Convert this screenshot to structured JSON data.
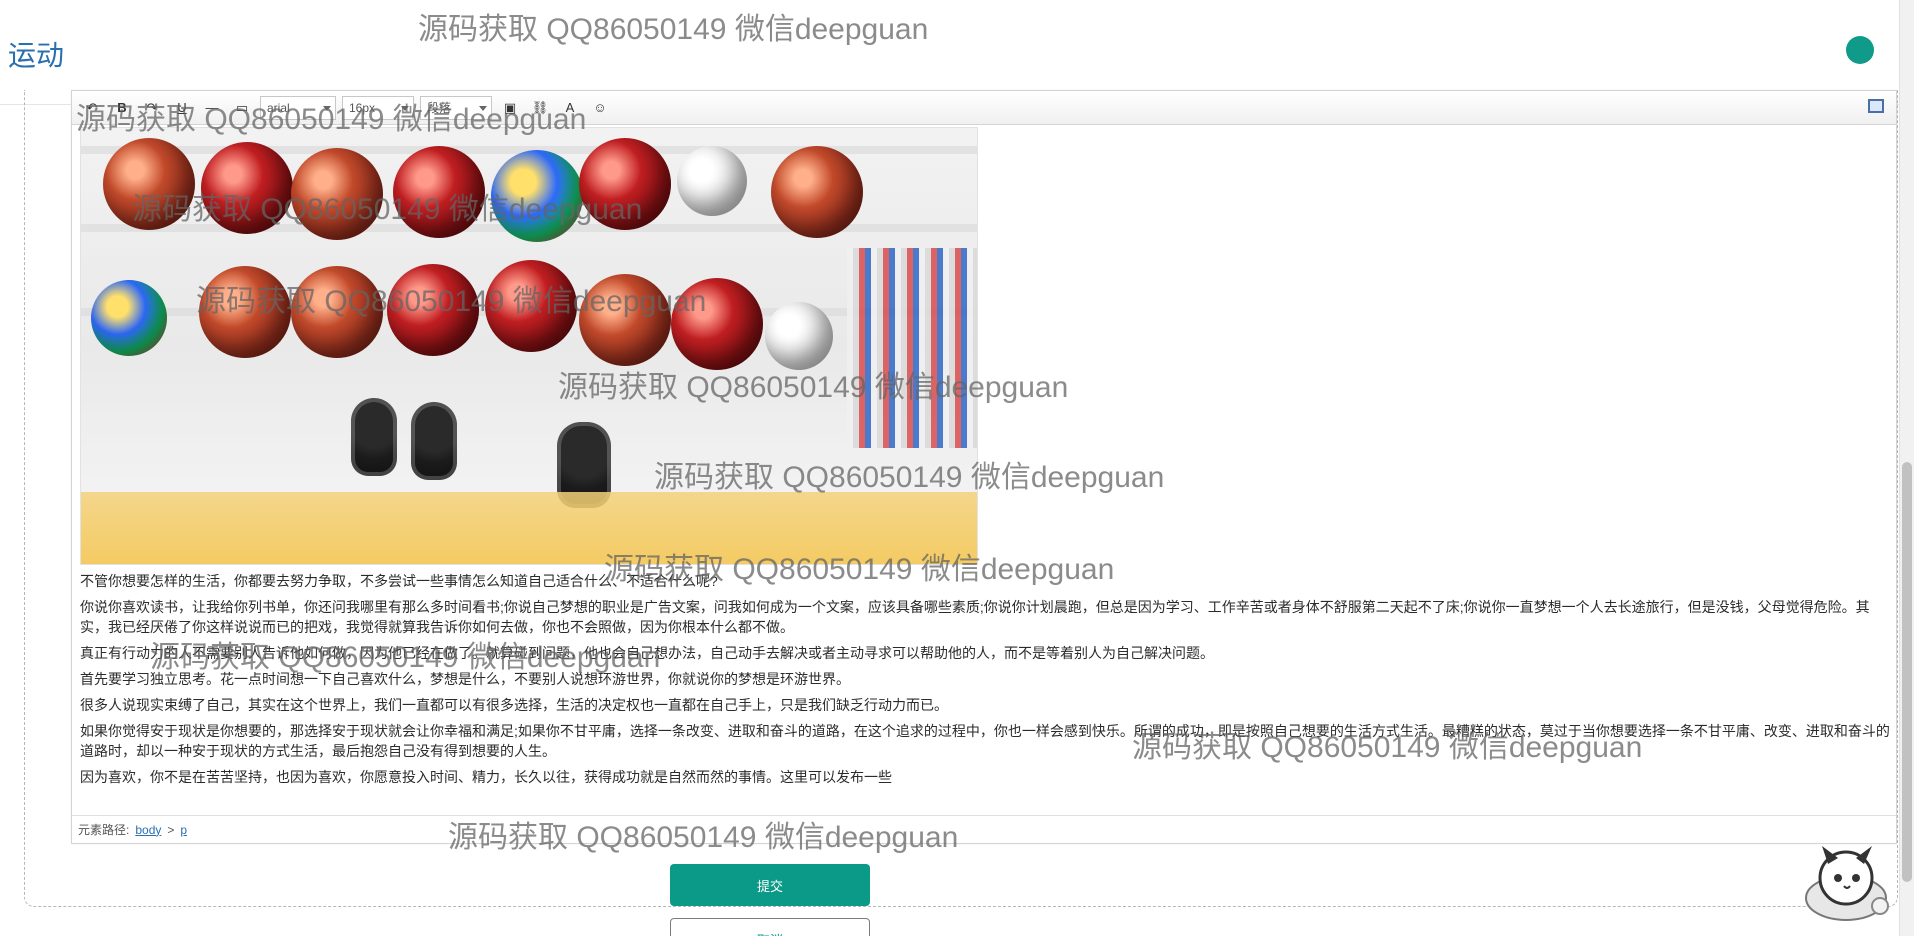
{
  "app": {
    "title": "运动"
  },
  "toolbar": {
    "font_family": "arial",
    "font_size": "16px",
    "paragraph": "段落"
  },
  "editor": {
    "image": {
      "alt_name": "sports-equipment-photo"
    },
    "paragraphs": [
      "不管你想要怎样的生活，你都要去努力争取，不多尝试一些事情怎么知道自己适合什么、不适合什么呢?",
      "你说你喜欢读书，让我给你列书单，你还问我哪里有那么多时间看书;你说自己梦想的职业是广告文案，问我如何成为一个文案，应该具备哪些素质;你说你计划晨跑，但总是因为学习、工作辛苦或者身体不舒服第二天起不了床;你说你一直梦想一个人去长途旅行，但是没钱，父母觉得危险。其实，我已经厌倦了你这样说说而已的把戏，我觉得就算我告诉你如何去做，你也不会照做，因为你根本什么都不做。",
      "真正有行动力的人不需要别人告诉他如何做，因为他已经在做了。就算碰到问题，他也会自己想办法，自己动手去解决或者主动寻求可以帮助他的人，而不是等着别人为自己解决问题。",
      "首先要学习独立思考。花一点时间想一下自己喜欢什么，梦想是什么，不要别人说想环游世界，你就说你的梦想是环游世界。",
      "很多人说现实束缚了自己，其实在这个世界上，我们一直都可以有很多选择，生活的决定权也一直都在自己手上，只是我们缺乏行动力而已。",
      "如果你觉得安于现状是你想要的，那选择安于现状就会让你幸福和满足;如果你不甘平庸，选择一条改变、进取和奋斗的道路，在这个追求的过程中，你也一样会感到快乐。所谓的成功，即是按照自己想要的生活方式生活。最糟糕的状态，莫过于当你想要选择一条不甘平庸、改变、进取和奋斗的道路时，却以一种安于现状的方式生活，最后抱怨自己没有得到想要的人生。",
      "因为喜欢，你不是在苦苦坚持，也因为喜欢，你愿意投入时间、精力，长久以往，获得成功就是自然而然的事情。这里可以发布一些"
    ],
    "path_label": "元素路径:",
    "path_items": [
      "body",
      "p"
    ]
  },
  "buttons": {
    "submit_label": "提交",
    "cancel_label": "取消"
  },
  "watermark_text": "源码获取 QQ86050149 微信deepguan",
  "colors": {
    "accent": "#0b9988",
    "link": "#2a6fb0",
    "watermark": "#6f6f6f"
  }
}
